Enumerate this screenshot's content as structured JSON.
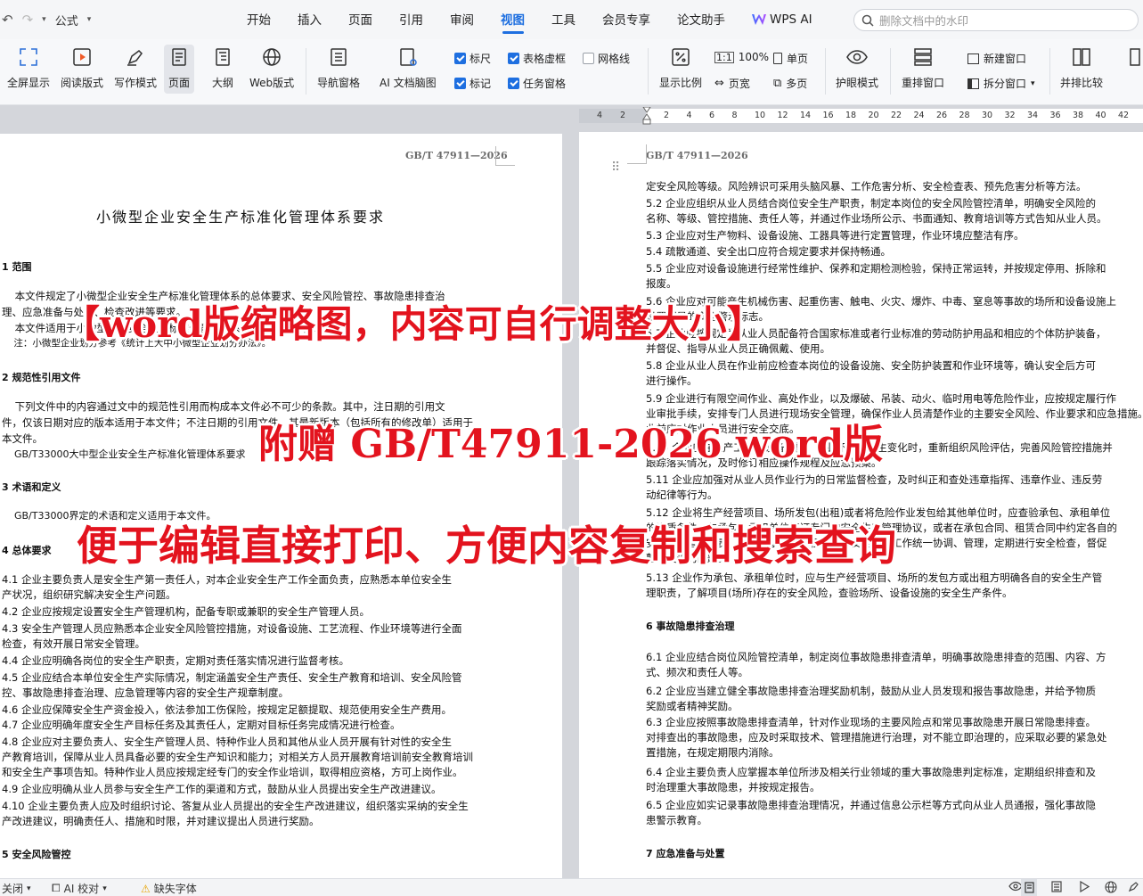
{
  "quick_access": {
    "format_label": "公式"
  },
  "menu_tabs": [
    "开始",
    "插入",
    "页面",
    "引用",
    "审阅",
    "视图",
    "工具",
    "会员专享",
    "论文助手",
    "WPS AI"
  ],
  "active_tab": "视图",
  "search": {
    "placeholder": "删除文档中的水印"
  },
  "ribbon": {
    "fullscreen": "全屏显示",
    "reading": "阅读版式",
    "writing": "写作模式",
    "page": "页面",
    "outline": "大纲",
    "web": "Web版式",
    "nav_pane": "导航窗格",
    "ai_mindmap": "AI 文档脑图",
    "chk_ruler": "标尺",
    "chk_table_gridlines": "表格虚框",
    "chk_gridlines": "网格线",
    "chk_marks": "标记",
    "chk_task_pane": "任务窗格",
    "zoom": "显示比例",
    "zoom_100": "100%",
    "page_width": "页宽",
    "single_page": "单页",
    "multi_page": "多页",
    "eye_mode": "护眼模式",
    "arrange_window": "重排窗口",
    "new_window": "新建窗口",
    "split_window": "拆分窗口",
    "side_by_side": "并排比较"
  },
  "ruler_ticks": [
    "4",
    "2",
    "2",
    "4",
    "6",
    "8",
    "10",
    "12",
    "14",
    "16",
    "18",
    "20",
    "22",
    "24",
    "26",
    "28",
    "30",
    "32",
    "34",
    "36",
    "38",
    "40",
    "42"
  ],
  "left_page": {
    "header": "GB/T 47911—2026",
    "title": "小微型企业安全生产标准化管理体系要求",
    "sections": {
      "s1": "1 范围",
      "s2": "2 规范性引用文件",
      "s3": "3 术语和定义",
      "s4": "4 总体要求",
      "s5": "5 安全风险管控"
    },
    "paragraphs": [
      "    本文件规定了小微型企业安全生产标准化管理体系的总体要求、安全风险管控、事故隐患排查治",
      "理、应急准备与处置、检查改进等要求。",
      "    本文件适用于小微型企业安全生产标准化管理体系的建立、实施和评价。",
      "    注：小微型企业划分参考《统计上大中小微型企业划分办法》。",
      "    下列文件中的内容通过文中的规范性引用而构成本文件必不可少的条款。其中，注日期的引用文",
      "件，仅该日期对应的版本适用于本文件；不注日期的引用文件，其最新版本（包括所有的修改单）适用于",
      "本文件。",
      "    GB/T33000大中型企业安全生产标准化管理体系要求",
      "    GB/T33000界定的术语和定义适用于本文件。",
      "4.1 企业主要负责人是安全生产第一责任人，对本企业安全生产工作全面负责，应熟悉本单位安全生",
      "产状况，组织研究解决安全生产问题。",
      "4.2 企业应按规定设置安全生产管理机构，配备专职或兼职的安全生产管理人员。",
      "4.3 安全生产管理人员应熟悉本企业安全风险管控措施，对设备设施、工艺流程、作业环境等进行全面",
      "检查，有效开展日常安全管理。",
      "4.4 企业应明确各岗位的安全生产职责，定期对责任落实情况进行监督考核。",
      "4.5 企业应结合本单位安全生产实际情况，制定涵盖安全生产责任、安全生产教育和培训、安全风险管",
      "控、事故隐患排查治理、应急管理等内容的安全生产规章制度。",
      "4.6 企业应保障安全生产资金投入，依法参加工伤保险，按规定足额提取、规范使用安全生产费用。",
      "4.7 企业应明确年度安全生产目标任务及其责任人，定期对目标任务完成情况进行检查。",
      "4.8 企业应对主要负责人、安全生产管理人员、特种作业人员和其他从业人员开展有针对性的安全生",
      "产教育培训，保障从业人员具备必要的安全生产知识和能力；对相关方人员开展教育培训前安全教育培训",
      "和安全生产事项告知。特种作业人员应按规定经专门的安全作业培训，取得相应资格，方可上岗作业。",
      "4.9 企业应明确从业人员参与安全生产工作的渠道和方式，鼓励从业人员提出安全生产改进建议。",
      "4.10 企业主要负责人应及时组织讨论、答复从业人员提出的安全生产改进建议，组织落实采纳的安全生",
      "产改进建议，明确责任人、措施和时限，并对建议提出人员进行奖励。"
    ]
  },
  "right_page": {
    "header": "GB/T 47911—2026",
    "sections": {
      "s6": "6 事故隐患排查治理",
      "s7": "7 应急准备与处置"
    },
    "paragraphs": [
      "定安全风险等级。风险辨识可采用头脑风暴、工作危害分析、安全检查表、预先危害分析等方法。",
      "5.2 企业应组织从业人员结合岗位安全生产职责，制定本岗位的安全风险管控清单，明确安全风险的",
      "名称、等级、管控措施、责任人等，并通过作业场所公示、书面通知、教育培训等方式告知从业人员。",
      "5.3 企业应对生产物料、设备设施、工器具等进行定置管理，作业环境应整洁有序。",
      "5.4 疏散通道、安全出口应符合规定要求并保持畅通。",
      "5.5 企业应对设备设施进行经常性维护、保养和定期检测检验，保持正常运转，并按规定停用、拆除和",
      "报废。",
      "5.6 企业应对可能产生机械伤害、起重伤害、触电、火灾、爆炸、中毒、窒息等事故的场所和设备设施上",
      "设置明显的安全警示标志。",
      "5.7 企业应按规定为从业人员配备符合国家标准或者行业标准的劳动防护用品和相应的个体防护装备，",
      "并督促、指导从业人员正确佩戴、使用。",
      "5.8 企业从业人员在作业前应检查本岗位的设备设施、安全防护装置和作业环境等，确认安全后方可",
      "进行操作。",
      "5.9 企业进行有限空间作业、高处作业，以及爆破、吊装、动火、临时用电等危险作业，应按规定履行作",
      "业审批手续，安排专门人员进行现场安全管理，确保作业人员清楚作业的主要安全风险、作业要求和应急措施。作",
      "业前应对作业人员进行安全交底。",
      "5.10 企业应在生产工艺、设备设施、作业环境等发生变化时，重新组织风险评估，完善风险管控措施并",
      "跟踪落实情况，及时修订相应操作规程及应急预案。",
      "5.11 企业应加强对从业人员作业行为的日常监督检查，及时纠正和查处违章指挥、违章作业、违反劳",
      "动纪律等行为。",
      "5.12 企业将生产经营项目、场所发包(出租)或者将危险作业发包给其他单位时，应查验承包、承租单位",
      "的资质条件，与承包、承租单位签订专门的安全生产管理协议，或者在承包合同、租赁合同中约定各自的",
      "安全生产管理职责；企业对承包、承租单位的安全生产工作统一协调、管理，定期进行安全检查，督促",
      "整改发现的问题。",
      "5.13 企业作为承包、承租单位时，应与生产经营项目、场所的发包方或出租方明确各自的安全生产管",
      "理职责，了解项目(场所)存在的安全风险，查验场所、设备设施的安全生产条件。",
      "6.1 企业应结合岗位风险管控清单，制定岗位事故隐患排查清单，明确事故隐患排查的范围、内容、方",
      "式、频次和责任人等。",
      "6.2 企业应当建立健全事故隐患排查治理奖励机制，鼓励从业人员发现和报告事故隐患，并给予物质",
      "奖励或者精神奖励。",
      "6.3 企业应按照事故隐患排查清单，针对作业现场的主要风险点和常见事故隐患开展日常隐患排查。",
      "对排查出的事故隐患，应及时采取技术、管理措施进行治理，对不能立即治理的，应采取必要的紧急处",
      "置措施，在规定期限内消除。",
      "6.4 企业主要负责人应掌握本单位所涉及相关行业领域的重大事故隐患判定标准，定期组织排查和及",
      "时治理重大事故隐患，并按规定报告。",
      "6.5 企业应如实记录事故隐患排查治理情况，并通过信息公示栏等方式向从业人员通报，强化事故隐",
      "患警示教育。"
    ]
  },
  "overlay": {
    "line1": "【word版缩略图，内容可自行调整大小】",
    "line2": "附赠 GB/T47911-2026 word版",
    "line3": "便于编辑直接打印、方便内容复制和搜索查询"
  },
  "status_bar": {
    "close": "关闭",
    "ai_proofread": "AI 校对",
    "missing_font": "缺失字体"
  },
  "colors": {
    "accent": "#1e6fe0",
    "overlay_red": "#e3131e"
  }
}
